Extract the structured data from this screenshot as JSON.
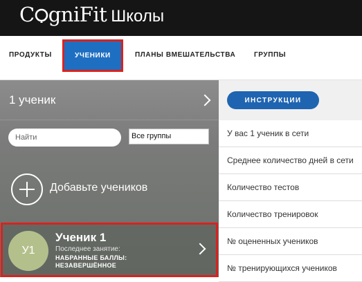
{
  "brand": {
    "logo_text_a": "C",
    "logo_text_b": "gniFit",
    "suffix": "Школы"
  },
  "nav": {
    "items": [
      {
        "label": "ПРОДУКТЫ"
      },
      {
        "label": "УЧЕНИКИ",
        "active": true
      },
      {
        "label": "ПЛАНЫ ВМЕШАТЕЛЬСТВА"
      },
      {
        "label": "ГРУППЫ"
      }
    ]
  },
  "students_panel": {
    "count_label": "1 ученик",
    "search_placeholder": "Найти",
    "group_filter": "Все группы",
    "add_label": "Добавьте учеников",
    "student": {
      "initials": "У1",
      "name": "Ученик 1",
      "last_session": "Последнее занятие:",
      "score_label": "НАБРАННЫЕ БАЛЛЫ: НЕЗАВЕРШЁННОЕ"
    }
  },
  "stats_panel": {
    "instructions_label": "ИНСТРУКЦИИ",
    "rows": [
      {
        "label": "У вас 1 ученик в сети"
      },
      {
        "label": "Среднее количество дней в сети"
      },
      {
        "label": "Количество тестов"
      },
      {
        "label": "Количество тренировок"
      },
      {
        "label": "№ оцененных учеников"
      },
      {
        "label": "№ тренирующихся учеников"
      }
    ]
  },
  "colors": {
    "header_bg": "#151515",
    "accent_blue": "#1e6fc2",
    "highlight_red": "#d9221f",
    "avatar_bg": "#b4c08c"
  }
}
